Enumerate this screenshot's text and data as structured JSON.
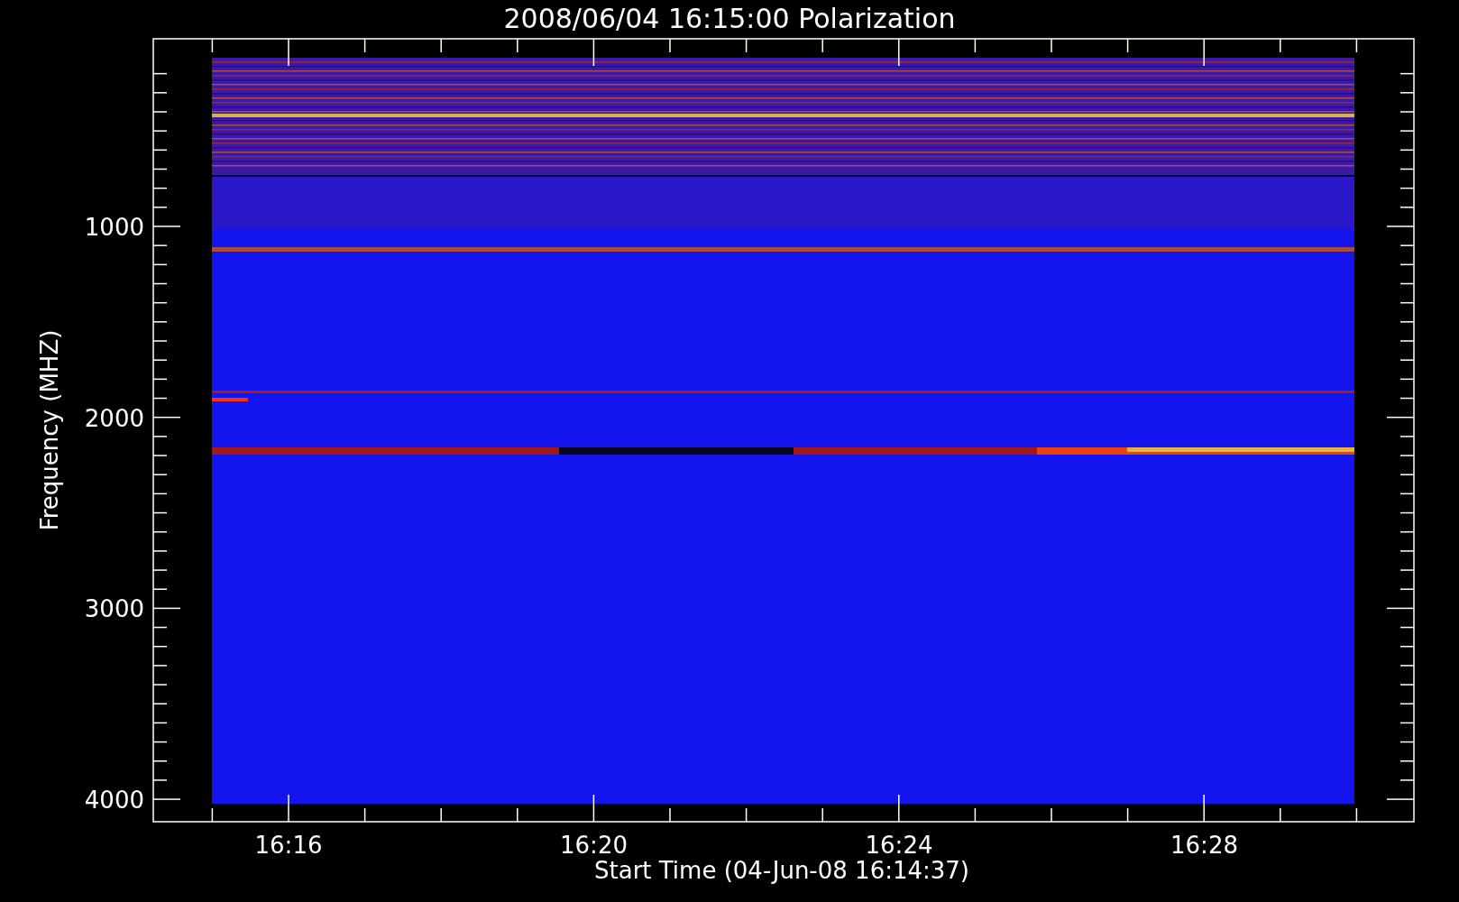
{
  "title": "2008/06/04 16:15:00 Polarization",
  "plot": {
    "ylabel": "Frequency (MHZ)",
    "xlabel": "Start Time (04-Jun-08 16:14:37)",
    "yticks": [
      "1000",
      "2000",
      "3000",
      "4000"
    ],
    "xticks": [
      "16:16",
      "16:20",
      "16:24",
      "16:28"
    ]
  }
}
